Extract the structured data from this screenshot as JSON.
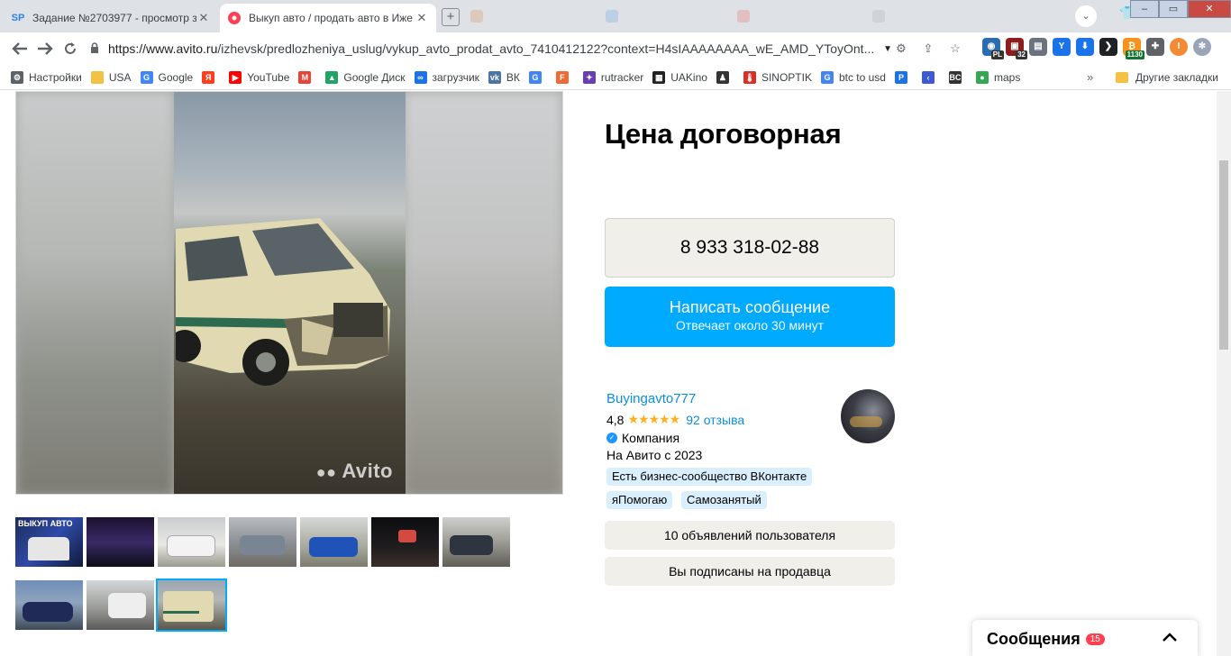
{
  "browser": {
    "tabs": [
      {
        "favicon": "SP",
        "title": "Задание №2703977 - просмотр з",
        "close": "✕"
      },
      {
        "favicon": "avito-icon",
        "title": "Выкуп авто / продать авто в Иже",
        "close": "✕"
      }
    ],
    "new_tab": "+",
    "window_controls": {
      "minimize": "–",
      "maximize": "▭",
      "close": "✕"
    },
    "url_host": "https://www.avito.ru",
    "url_path": "/izhevsk/predlozheniya_uslug/vykup_avto_prodat_avto_7410412122?context=H4sIAAAAAAAA_wE_AMD_YToyOnt...",
    "extension_badges": {
      "pl": "PL",
      "count32": "32",
      "time": "1130"
    },
    "profile_initial": "I"
  },
  "bookmarks": [
    {
      "label": "Настройки",
      "icon": "gear-icon",
      "color": "#5f6368"
    },
    {
      "label": "USA",
      "icon": "folder-icon",
      "color": "#f4c242"
    },
    {
      "label": "Google",
      "icon": "google-icon",
      "color": "#4285f4"
    },
    {
      "label": "",
      "icon": "yandex-icon",
      "color": "#fc3f1d"
    },
    {
      "label": "YouTube",
      "icon": "youtube-icon",
      "color": "#ff0000"
    },
    {
      "label": "",
      "icon": "gmail-icon",
      "color": "#ea4335"
    },
    {
      "label": "Google Диск",
      "icon": "drive-icon",
      "color": "#1fa463"
    },
    {
      "label": "загрузчик",
      "icon": "infinity-icon",
      "color": "#1a73e8"
    },
    {
      "label": "ВК",
      "icon": "vk-icon",
      "color": "#4c75a3"
    },
    {
      "label": "",
      "icon": "translate-icon",
      "color": "#4285f4"
    },
    {
      "label": "",
      "icon": "f-icon",
      "color": "#f06a35"
    },
    {
      "label": "rutracker",
      "icon": "rutracker-icon",
      "color": "#6a3fb3"
    },
    {
      "label": "UAKino",
      "icon": "film-icon",
      "color": "#222222"
    },
    {
      "label": "",
      "icon": "person-icon",
      "color": "#333333"
    },
    {
      "label": "SINOPTIK",
      "icon": "thermometer-icon",
      "color": "#d93025"
    },
    {
      "label": "btc to usd",
      "icon": "google-icon",
      "color": "#4285f4"
    },
    {
      "label": "",
      "icon": "p-icon",
      "color": "#1a73e8"
    },
    {
      "label": "",
      "icon": "chevron-left-icon",
      "color": "#3c59d6"
    },
    {
      "label": "",
      "icon": "bc-icon",
      "color": "#333333"
    },
    {
      "label": "maps",
      "icon": "maps-icon",
      "color": "#34a853"
    }
  ],
  "bookmarks_more": "»",
  "bookmarks_other": "Другие закладки",
  "listing": {
    "watermark": "Avito",
    "price": "Цена договорная",
    "phone": "8 933 318-02-88",
    "message_button": {
      "title": "Написать сообщение",
      "subtitle": "Отвечает около 30 минут"
    },
    "seller": {
      "name": "Buyingavto777",
      "rating": "4,8",
      "stars": "★★★★★",
      "reviews": "92 отзыва",
      "type": "Компания",
      "since": "На Авито с 2023"
    },
    "tags": [
      "Есть бизнес-сообщество ВКонтакте",
      "яПомогаю",
      "Самозанятый"
    ],
    "user_ads_button": "10 объявлений пользователя",
    "subscribed_button": "Вы подписаны на продавца",
    "thumbnail_caption": "ВЫКУП АВТО"
  },
  "messages_widget": {
    "label": "Сообщения",
    "count": "15"
  }
}
